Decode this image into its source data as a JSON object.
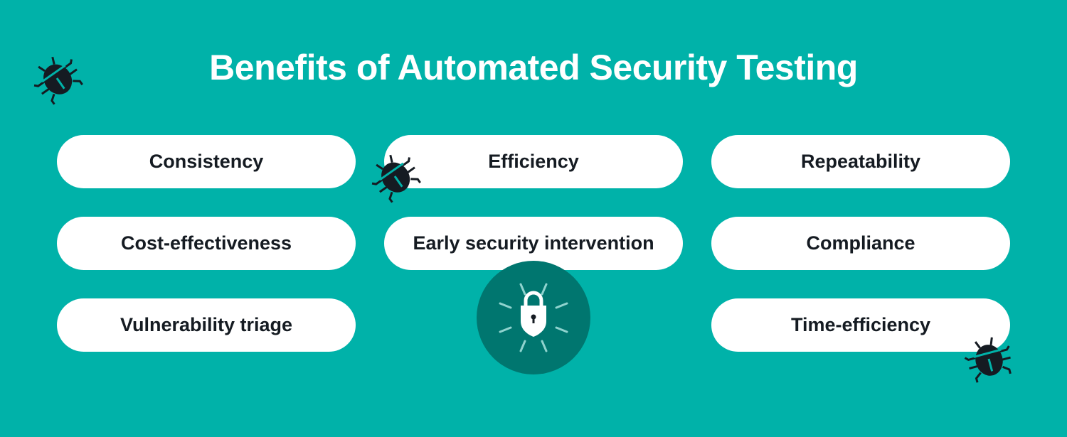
{
  "title": "Benefits of Automated Security Testing",
  "benefits": [
    {
      "label": "Consistency"
    },
    {
      "label": "Efficiency"
    },
    {
      "label": "Repeatability"
    },
    {
      "label": "Cost-effectiveness"
    },
    {
      "label": "Early security intervention"
    },
    {
      "label": "Compliance"
    },
    {
      "label": "Vulnerability triage"
    },
    {
      "label": "Time-efficiency"
    }
  ],
  "icons": {
    "bug": "bug-icon",
    "lock": "padlock-icon"
  },
  "colors": {
    "background": "#00b2a9",
    "pill": "#ffffff",
    "text": "#151b22",
    "lock_circle": "#00766f"
  }
}
